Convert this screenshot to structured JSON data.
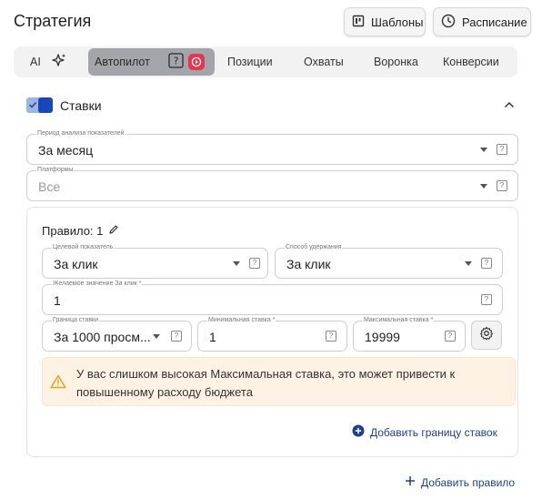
{
  "header": {
    "title": "Стратегия",
    "templates_label": "Шаблоны",
    "schedule_label": "Расписание"
  },
  "tabs": {
    "ai": "AI",
    "autopilot": "Автопилот",
    "positions": "Позиции",
    "reach": "Охваты",
    "funnel": "Воронка",
    "conversions": "Конверсии"
  },
  "bids": {
    "title": "Ставки",
    "enabled": true,
    "period": {
      "label": "Период анализа показателей",
      "value": "За месяц"
    },
    "platforms": {
      "label": "Платформы",
      "value": "Все"
    }
  },
  "rule": {
    "title": "Правило: 1",
    "target_metric": {
      "label": "Целевой показатель",
      "value": "За клик"
    },
    "hold_method": {
      "label": "Способ удержания",
      "value": "За клик"
    },
    "desired_value": {
      "label": "Желаемое значение За клик *",
      "value": "1"
    },
    "bid_border": {
      "label": "Граница ставки",
      "value": "За 1000 просм..."
    },
    "min_bid": {
      "label": "Минимальная ставка *",
      "value": "1"
    },
    "max_bid": {
      "label": "Максимальная ставка *",
      "value": "19999"
    },
    "warning": "У вас слишком высокая Максимальная ставка, это может привести к повышенному расходу бюджета",
    "add_border_label": "Добавить границу ставок"
  },
  "add_rule_label": "Добавить правило",
  "icons": {
    "templates": "board-icon",
    "schedule": "clock-icon",
    "ai": "sparkle-icon",
    "help": "question-square-icon",
    "autopilot_badge": "play-badge-icon",
    "collapse": "chevron-up-icon",
    "edit": "pencil-icon",
    "settings": "gear-icon",
    "warning": "warning-triangle-icon",
    "add_circle": "plus-circle-icon",
    "add": "plus-icon"
  },
  "colors": {
    "accent": "#1946b8",
    "link": "#1d3f8f",
    "warning_bg": "#fdf2e3",
    "warning_icon": "#e0a420",
    "badge_red": "#e8344e"
  }
}
